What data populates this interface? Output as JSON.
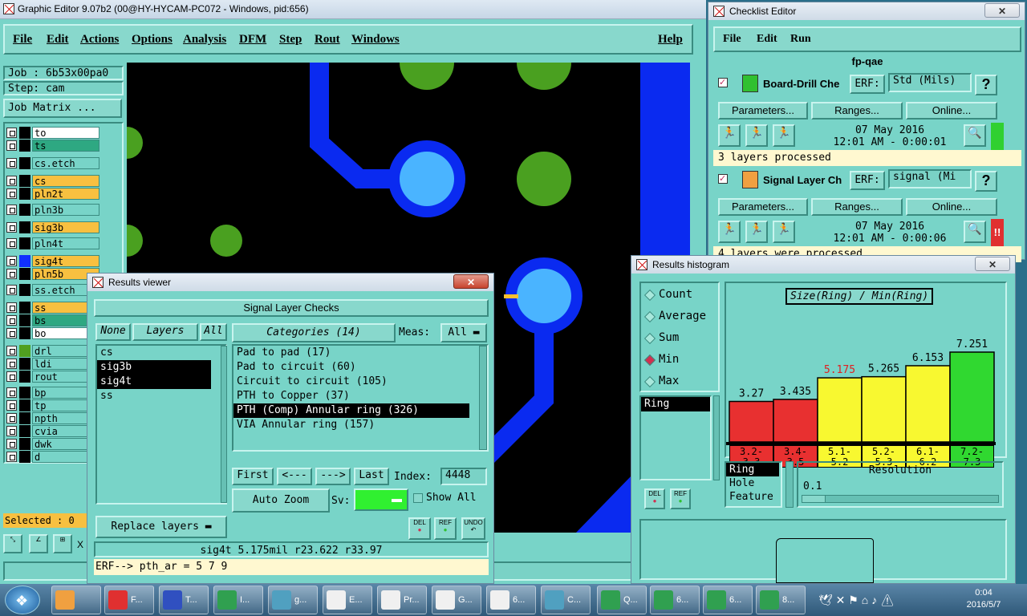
{
  "main": {
    "title": "Graphic Editor 9.07b2 (00@HY-HYCAM-PC072 - Windows, pid:656)",
    "menus": [
      "File",
      "Edit",
      "Actions",
      "Options",
      "Analysis",
      "DFM",
      "Step",
      "Rout",
      "Windows"
    ],
    "help": "Help",
    "job": "Job : 6b53x00pa0",
    "step": "Step: cam",
    "job_matrix": "Job Matrix ...",
    "layers": [
      {
        "name": "to",
        "color": "#ffffff",
        "swatch": "#000000"
      },
      {
        "name": "ts",
        "color": "#2ea882",
        "swatch": "#000000"
      },
      {
        "name": "cs.etch",
        "color": "#78d4c8",
        "swatch": "#000000"
      },
      {
        "name": "cs",
        "color": "#f8c040",
        "swatch": "#000000"
      },
      {
        "name": "pln2t",
        "color": "#f8c040",
        "swatch": "#000000"
      },
      {
        "name": "pln3b",
        "color": "#78d4c8",
        "swatch": "#000000"
      },
      {
        "name": "sig3b",
        "color": "#f8c040",
        "swatch": "#000000"
      },
      {
        "name": "pln4t",
        "color": "#78d4c8",
        "swatch": "#000000"
      },
      {
        "name": "sig4t",
        "color": "#f8c040",
        "swatch": "#1030ff"
      },
      {
        "name": "pln5b",
        "color": "#f8c040",
        "swatch": "#000000"
      },
      {
        "name": "ss.etch",
        "color": "#78d4c8",
        "swatch": "#000000"
      },
      {
        "name": "ss",
        "color": "#f8c040",
        "swatch": "#000000"
      },
      {
        "name": "bs",
        "color": "#2ea882",
        "swatch": "#000000"
      },
      {
        "name": "bo",
        "color": "#ffffff",
        "swatch": "#000000"
      },
      {
        "name": "drl",
        "color": "#78d4c8",
        "swatch": "#50a020"
      },
      {
        "name": "ldi",
        "color": "#78d4c8",
        "swatch": "#000000"
      },
      {
        "name": "rout",
        "color": "#78d4c8",
        "swatch": "#000000"
      },
      {
        "name": "bp",
        "color": "#78d4c8",
        "swatch": "#000000"
      },
      {
        "name": "tp",
        "color": "#78d4c8",
        "swatch": "#000000"
      },
      {
        "name": "npth",
        "color": "#78d4c8",
        "swatch": "#000000"
      },
      {
        "name": "cvia",
        "color": "#78d4c8",
        "swatch": "#000000"
      },
      {
        "name": "dwk",
        "color": "#78d4c8",
        "swatch": "#000000"
      },
      {
        "name": "d",
        "color": "#78d4c8",
        "swatch": "#000000"
      }
    ],
    "selected": "Selected : 0",
    "status_x": "X"
  },
  "checklist": {
    "title": "Checklist Editor",
    "menus": [
      "File",
      "Edit",
      "Run"
    ],
    "name": "fp-qae",
    "erf_label": "ERF:",
    "params": "Parameters...",
    "ranges": "Ranges...",
    "online": "Online...",
    "help": "?",
    "items": [
      {
        "name": "Board-Drill Che",
        "erf": "Std (Mils)",
        "date": "07 May 2016",
        "time": "12:01 AM - 0:00:01",
        "msg": "3 layers processed",
        "status": "#30d030",
        "mark": ""
      },
      {
        "name": "Signal Layer Ch",
        "erf": "signal (Mi",
        "date": "07 May 2016",
        "time": "12:01 AM - 0:00:06",
        "msg": "4 layers were processed",
        "status": "#e03030",
        "mark": "!!"
      }
    ]
  },
  "results": {
    "title": "Results viewer",
    "header": "Signal Layer Checks",
    "none": "None",
    "layers": "Layers",
    "all": "All",
    "categories_label": "Categories (14)",
    "meas_label": "Meas:",
    "meas_value": "All",
    "layer_list": [
      "cs",
      "sig3b",
      "sig4t",
      "ss"
    ],
    "layer_selected": [
      false,
      true,
      true,
      false
    ],
    "category_list": [
      "Pad to pad (17)",
      "Pad to circuit (60)",
      "Circuit to circuit (105)",
      "PTH to Copper (37)",
      "PTH (Comp) Annular ring (326)",
      "VIA Annular ring (157)"
    ],
    "category_selected_index": 4,
    "first": "First",
    "prev": "<---",
    "next": "--->",
    "last": "Last",
    "index_label": "Index:",
    "index_value": "4448",
    "auto_zoom": "Auto Zoom",
    "sv_label": "Sv:",
    "show_all": "Show All",
    "replace_layers": "Replace layers",
    "del": "DEL",
    "ref": "REF",
    "undo": "UNDO",
    "status": "sig4t 5.175mil  r23.622  r33.97",
    "erf_line": "ERF--> pth_ar = 5 7 9"
  },
  "histogram": {
    "title": "Results histogram",
    "options": [
      "Count",
      "Average",
      "Sum",
      "Min",
      "Max"
    ],
    "option_selected": "Min",
    "chart_title": "Size(Ring) / Min(Ring)",
    "ring_list": [
      "Ring"
    ],
    "bottom_list": [
      "Ring",
      "Hole",
      "Feature"
    ],
    "resolution_label": "Resolution",
    "resolution_value": "0.1",
    "del": "DEL",
    "ref": "REF",
    "chart_data": {
      "type": "bar",
      "categories": [
        "3.2-3.3",
        "3.4-3.5",
        "5.1-5.2",
        "5.2-5.3",
        "6.1-6.2",
        "7.2-7.3"
      ],
      "values": [
        3.27,
        3.435,
        5.175,
        5.265,
        6.153,
        7.251
      ],
      "labels": [
        "3.27",
        "3.435",
        "5.175",
        "5.265",
        "6.153",
        "7.251"
      ],
      "colors": [
        "#e83030",
        "#e83030",
        "#f8f830",
        "#f8f830",
        "#f8f830",
        "#30d830"
      ],
      "label_colors": [
        "#000000",
        "#000000",
        "#e02020",
        "#000000",
        "#000000",
        "#000000"
      ],
      "ylim": [
        0,
        7.251
      ]
    }
  },
  "taskbar": {
    "items": [
      {
        "label": "",
        "color": "#f0a040"
      },
      {
        "label": "F...",
        "color": "#e03030"
      },
      {
        "label": "T...",
        "color": "#3050c0"
      },
      {
        "label": "I...",
        "color": "#30a050"
      },
      {
        "label": "g...",
        "color": "#50a0c0"
      },
      {
        "label": "E...",
        "color": "#f0f0f0"
      },
      {
        "label": "Pr...",
        "color": "#f0f0f0"
      },
      {
        "label": "G...",
        "color": "#f0f0f0"
      },
      {
        "label": "6...",
        "color": "#f0f0f0"
      },
      {
        "label": "C...",
        "color": "#50a0c0"
      },
      {
        "label": "Q...",
        "color": "#30a050"
      },
      {
        "label": "6...",
        "color": "#30a050"
      },
      {
        "label": "6...",
        "color": "#30a050"
      },
      {
        "label": "8...",
        "color": "#30a050"
      }
    ],
    "time": "0:04",
    "date": "2016/5/7"
  }
}
